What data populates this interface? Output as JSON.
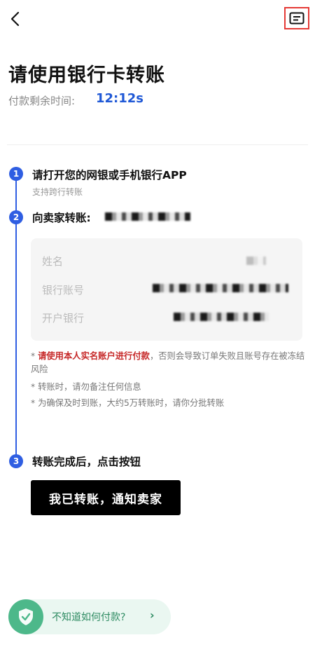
{
  "header": {
    "back_icon": "chevron-left-icon",
    "chat_icon": "message-icon"
  },
  "page": {
    "title": "请使用银行卡转账",
    "timer_label": "付款剩余时间:",
    "timer_value": "12:12s"
  },
  "steps": [
    {
      "number": "1",
      "text": "请打开您的网银或手机银行APP",
      "sub": "支持跨行转账"
    },
    {
      "number": "2",
      "text": "向卖家转账:"
    },
    {
      "number": "3",
      "text": "转账完成后，点击按钮"
    }
  ],
  "account_info": {
    "name_label": "姓名",
    "account_label": "银行账号",
    "bank_label": "开户银行"
  },
  "notes": {
    "note1_red": "请使用本人实名账户进行付款",
    "note1_rest": "，否则会导致订单失败且账号存在被冻结风险",
    "note2": "转账时，请勿备注任何信息",
    "note3": "为确保及时到账，大约5万转账时，请你分批转账",
    "bullet": "*"
  },
  "actions": {
    "confirm_label": "我已转账，通知卖家"
  },
  "help": {
    "text": "不知道如何付款?",
    "chevron": "›",
    "icon": "shield-check-icon"
  },
  "colors": {
    "accent": "#2f5ee2",
    "timer": "#1f58d6",
    "warning": "#c62828",
    "help_green": "#4db88a"
  }
}
